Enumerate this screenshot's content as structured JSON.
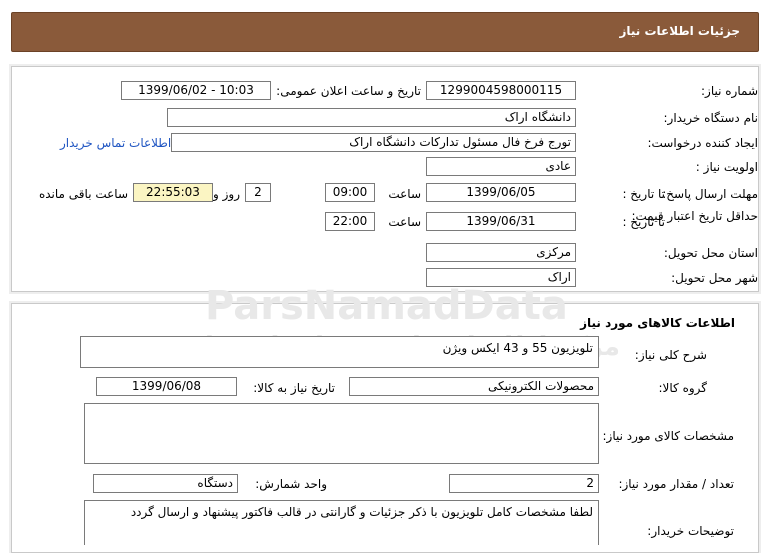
{
  "header": {
    "title": "جزئیات اطلاعات نیاز"
  },
  "watermark": {
    "brand": "ParsNamadData",
    "subtitle": "مرکز اطلاعات پارس نماد داده ها",
    "phone": "۰۲۱-۸۸۳۴۹۶۷۰-۵"
  },
  "details": {
    "need_number_label": "شماره نیاز:",
    "need_number": "1299004598000115",
    "announce_label": "تاریخ و ساعت اعلان عمومی:",
    "announce_value": "1399/06/02 - 10:03",
    "buyer_label": "نام دستگاه خریدار:",
    "buyer_value": "دانشگاه اراک",
    "creator_label": "ایجاد کننده درخواست:",
    "creator_value": "تورج فرخ فال مسئول تدارکات دانشگاه اراک",
    "contact_link": "اطلاعات تماس خریدار",
    "priority_label": "اولویت نیاز :",
    "priority_value": "عادی",
    "deadline_label": "مهلت ارسال پاسخ:",
    "until_date_label": "تا تاریخ :",
    "deadline_date": "1399/06/05",
    "time_label": "ساعت",
    "deadline_time": "09:00",
    "days_value": "2",
    "days_label": "روز و",
    "remaining_time": "22:55:03",
    "remaining_label": "ساعت باقی مانده",
    "validity_label": "حداقل تاریخ اعتبار قیمت:",
    "validity_date": "1399/06/31",
    "validity_time": "22:00",
    "province_label": "استان محل تحویل:",
    "province_value": "مرکزی",
    "city_label": "شهر محل تحویل:",
    "city_value": "اراک"
  },
  "goods": {
    "section_title": "اطلاعات کالاهای مورد نیاز",
    "summary_label": "شرح کلی نیاز:",
    "summary_value": "تلویزیون 55 و 43 ایکس ویژن",
    "group_label": "گروه کالا:",
    "group_value": "محصولات الکترونیکی",
    "need_date_label": "تاریخ نیاز به کالا:",
    "need_date_value": "1399/06/08",
    "specs_label": "مشخصات کالای مورد نیاز:",
    "specs_value": "",
    "qty_label": "تعداد / مقدار مورد نیاز:",
    "qty_value": "2",
    "unit_label": "واحد شمارش:",
    "unit_value": "دستگاه",
    "buyer_notes_label": "توضیحات خریدار:",
    "buyer_notes_value": "لطفا مشخصات کامل تلویزیون با ذکر جزئیات و گارانتی در قالب فاکتور پیشنهاد و ارسال گردد"
  }
}
